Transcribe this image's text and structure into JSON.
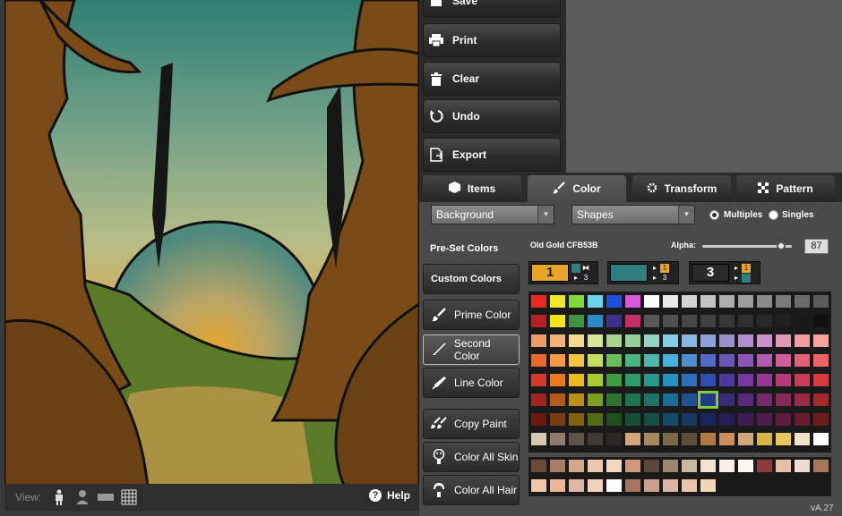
{
  "toolbar": {
    "save_label": "Save",
    "print_label": "Print",
    "clear_label": "Clear",
    "undo_label": "Undo",
    "export_label": "Export"
  },
  "tabs": {
    "items_label": "Items",
    "color_label": "Color",
    "transform_label": "Transform",
    "pattern_label": "Pattern"
  },
  "controls": {
    "layer_value": "Background",
    "category_value": "Shapes",
    "mode_multiples": "Multiples",
    "mode_singles": "Singles",
    "mode_selected": "Multiples"
  },
  "color_panel": {
    "preset_label": "Pre-Set Colors",
    "custom_label": "Custom Colors",
    "prime_label": "Prime Color",
    "second_label": "Second Color",
    "line_label": "Line Color",
    "copy_paint_label": "Copy Paint",
    "color_all_skin_label": "Color All Skin",
    "color_all_hair_label": "Color All Hair",
    "color_name": "Old Gold CFB53B",
    "alpha_label": "Alpha:",
    "alpha_value": "87",
    "slot1_number": "1",
    "slot3_number": "3",
    "slot_indicator_1": "1",
    "slot_indicator_3": "3"
  },
  "view_bar": {
    "view_label": "View:",
    "help_label": "Help"
  },
  "version": "vA.27",
  "palette": {
    "rows": [
      [
        "#ea2a22",
        "#f2e62a",
        "#7fdb33",
        "#6ad4e8",
        "#1e4fe0",
        "#d85ad8",
        "#ffffff",
        "#e9e9e9",
        "#d3d3d3",
        "#c3c3c3",
        "#adadad",
        "#9d9d9d",
        "#8b8b8b",
        "#7a7a7a",
        "#6a6a6a",
        "#5a5a5a"
      ],
      [
        "#b71f22",
        "#f1e316",
        "#3d9441",
        "#2b8ac4",
        "#3f2f8e",
        "#c43066",
        "#585858",
        "#4f4f4f",
        "#474747",
        "#404040",
        "#383838",
        "#303030",
        "#282828",
        "#202020",
        "#181818",
        "#101010"
      ],
      [
        "#ec9a66",
        "#f2b27a",
        "#f7d88d",
        "#d9e69a",
        "#a6d48d",
        "#95cf9a",
        "#8fd3c0",
        "#86cce4",
        "#88b7e0",
        "#8e9fd7",
        "#9c8fcf",
        "#b08fd0",
        "#c992c9",
        "#e29ab7",
        "#f09aa1",
        "#f4a49c"
      ],
      [
        "#e9682d",
        "#f19945",
        "#f5c340",
        "#c5dc5e",
        "#6dbd5d",
        "#4db584",
        "#4cb7a8",
        "#4ab0d9",
        "#4c8ed0",
        "#4f6bc5",
        "#6a56b9",
        "#8e56b8",
        "#b15cb0",
        "#cf5e98",
        "#e4607a",
        "#ec6466"
      ],
      [
        "#d5382a",
        "#e57a1e",
        "#efb81d",
        "#a8cc2e",
        "#3c9e3c",
        "#2b9b6e",
        "#249a8c",
        "#2493c4",
        "#2a6fbd",
        "#2f4db1",
        "#4d38a2",
        "#7638a1",
        "#96388f",
        "#b43a78",
        "#cc3b58",
        "#d73a3d"
      ],
      [
        "#a2241f",
        "#b45a1a",
        "#c08d16",
        "#7f9c22",
        "#2c7530",
        "#1f7452",
        "#1c7368",
        "#1c6d93",
        "#205291",
        "#233985",
        "#3a2a7c",
        "#5a2a7a",
        "#72296d",
        "#89295a",
        "#9a2a43",
        "#a22a2e"
      ],
      [
        "#6d1815",
        "#7a3c12",
        "#83600f",
        "#566a17",
        "#1d5021",
        "#154f38",
        "#134e47",
        "#134a64",
        "#163863",
        "#18275b",
        "#281c55",
        "#3d1c54",
        "#4d1c4a",
        "#5d1c3d",
        "#691d2e",
        "#6e1d1f"
      ],
      [
        "#d6c8b0",
        "#8d7c6b",
        "#605349",
        "#403934",
        "#2a2725",
        "#d2a878",
        "#a58a5c",
        "#7b6a48",
        "#5b4f37",
        "#b07a43",
        "#d08d5c",
        "#ceaa7b",
        "#d7b642",
        "#e8c85a",
        "#efe4c8",
        "#ffffff"
      ]
    ],
    "selected_row": 5,
    "selected_col": 9,
    "skin_rows": [
      [
        "#6b4a3a",
        "#a87e6a",
        "#d4a78c",
        "#ecc8b0",
        "#f2d7c1",
        "#d09680",
        "#5e4638",
        "#9b8a70",
        "#c8b9a0",
        "#f4e4cf",
        "#f7f0e4",
        "#fff8ef",
        "#8c3a3a",
        "#e6c0a8",
        "#f0dbcf",
        "#a4765c"
      ],
      [
        "#f0c6a8",
        "#e8b898",
        "#dbb9a6",
        "#f0d4c0",
        "#ffffff",
        "#a47560",
        "#cba088",
        "#d9b7a4",
        "#e8c7a9",
        "#efd7b7"
      ]
    ]
  },
  "colors": {
    "slot1": "#e8a52a",
    "slot2": "#2f7f80",
    "slot3": "#2a2a2a",
    "accent_select": "#7bd13b"
  }
}
